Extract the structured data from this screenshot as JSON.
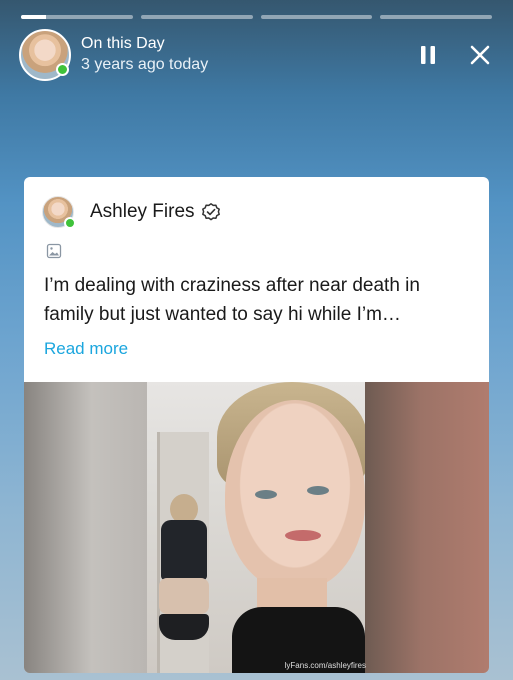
{
  "story": {
    "segments": 4,
    "progress": [
      0.22,
      0,
      0,
      0
    ]
  },
  "header": {
    "title": "On this Day",
    "subtitle": "3 years ago today",
    "pause_icon": "pause-icon",
    "close_icon": "close-icon"
  },
  "post": {
    "author_name": "Ashley Fires",
    "verified_icon": "verified-badge-icon",
    "media_type_icon": "image-icon",
    "text": "I’m dealing with craziness after near death in family but just wanted to say hi while I’m…",
    "read_more": "Read more",
    "watermark": "lyFans.com/ashleyfires"
  },
  "colors": {
    "online": "#3fc23a",
    "link": "#1ba6de"
  }
}
